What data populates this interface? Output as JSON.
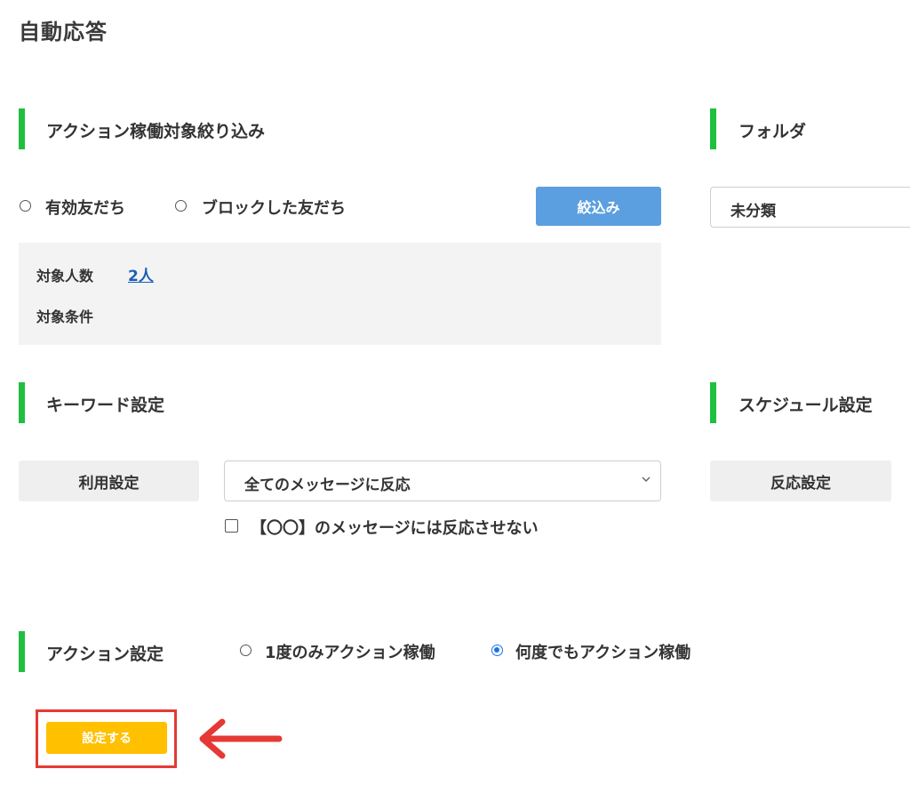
{
  "page": {
    "title": "自動応答"
  },
  "sections": {
    "filter": {
      "title": "アクション稼働対象絞り込み",
      "options": [
        "有効友だち",
        "ブロックした友だち"
      ],
      "button": "絞込み",
      "count_label": "対象人数",
      "count_value": "2人",
      "condition_label": "対象条件"
    },
    "folder": {
      "title": "フォルダ",
      "selected": "未分類"
    },
    "keyword": {
      "title": "キーワード設定",
      "usage_button": "利用設定",
      "selected": "全てのメッセージに反応",
      "checkbox_label": "【〇〇】のメッセージには反応させない"
    },
    "schedule": {
      "title": "スケジュール設定",
      "button": "反応設定"
    },
    "action": {
      "title": "アクション設定",
      "options": [
        "1度のみアクション稼働",
        "何度でもアクション稼働"
      ],
      "selected_index": 1
    }
  },
  "submit": {
    "label": "設定する"
  },
  "colors": {
    "accent_bar": "#1fbf3f",
    "filter_button": "#5b9fe0",
    "submit_button": "#ffc000",
    "highlight": "#e53935",
    "arrow": "#e53935"
  }
}
